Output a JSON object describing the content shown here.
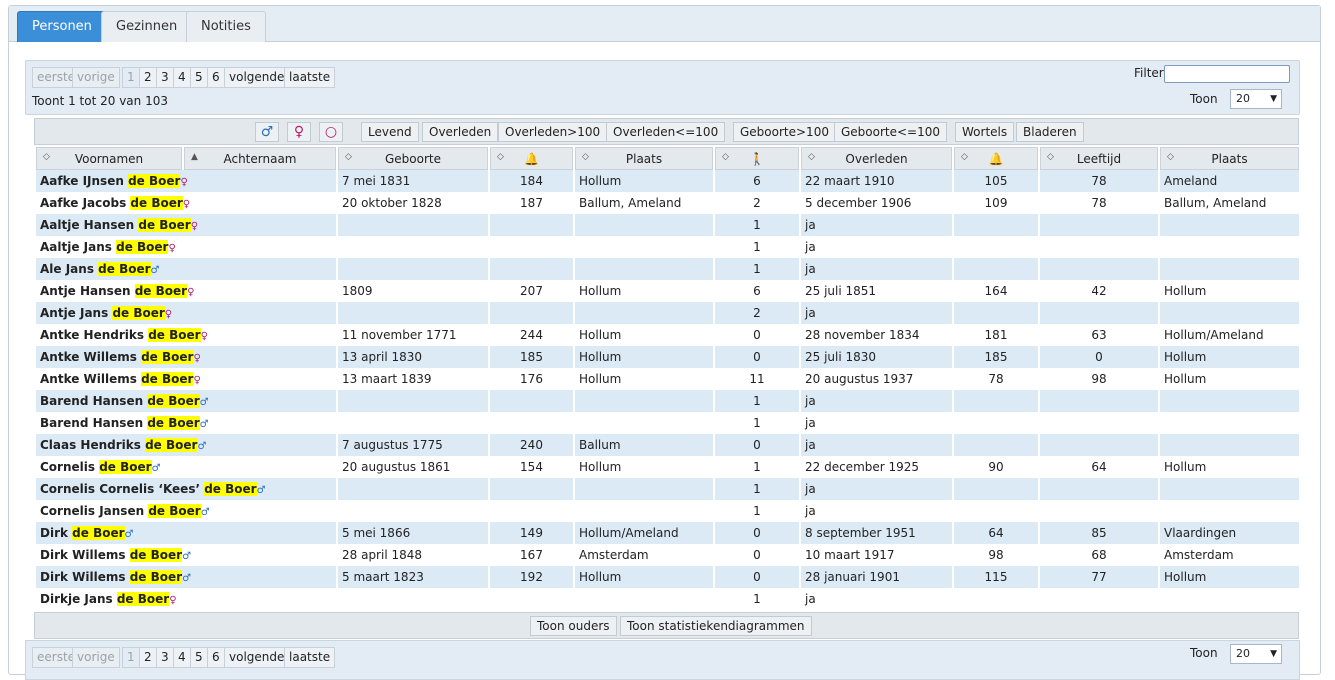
{
  "tabs": [
    "Personen",
    "Gezinnen",
    "Notities"
  ],
  "pager": {
    "first": "eerste",
    "prev": "vorige",
    "pages": [
      "1",
      "2",
      "3",
      "4",
      "5",
      "6"
    ],
    "next": "volgende",
    "last": "laatste",
    "showing": "Toont 1 tot 20 van 103"
  },
  "filter": {
    "label": "Filter",
    "value": ""
  },
  "page_size": {
    "label": "Toon",
    "value": "20"
  },
  "filter_buttons": [
    "Levend",
    "Overleden",
    "Overleden>100",
    "Overleden<=100",
    "Geboorte>100",
    "Geboorte<=100",
    "Wortels",
    "Bladeren"
  ],
  "sex_buttons": {
    "male": "♂",
    "female": "♀",
    "unknown": "○"
  },
  "columns": [
    "Voornamen",
    "Achternaam",
    "Geboorte",
    "",
    "Plaats",
    "",
    "Overleden",
    "",
    "Leeftijd",
    "Plaats"
  ],
  "column_icons": {
    "birth_anniversary": "bell-icon",
    "children": "family-walk-icon",
    "death_anniversary": "bell-icon"
  },
  "rows": [
    {
      "given": "Aafke IJnsen",
      "surname": "de Boer",
      "sex": "♀",
      "birth": "7 mei 1831",
      "ann": "184",
      "bplace": "Hollum",
      "kids": "6",
      "death": "22 maart 1910",
      "dann": "105",
      "age": "78",
      "dplace": "Ameland"
    },
    {
      "given": "Aafke Jacobs",
      "surname": "de Boer",
      "sex": "♀",
      "birth": "20 oktober 1828",
      "ann": "187",
      "bplace": "Ballum, Ameland",
      "kids": "2",
      "death": "5 december 1906",
      "dann": "109",
      "age": "78",
      "dplace": "Ballum, Ameland"
    },
    {
      "given": "Aaltje Hansen",
      "surname": "de Boer",
      "sex": "♀",
      "birth": "",
      "ann": "",
      "bplace": "",
      "kids": "1",
      "death": "ja",
      "dann": "",
      "age": "",
      "dplace": ""
    },
    {
      "given": "Aaltje Jans",
      "surname": "de Boer",
      "sex": "♀",
      "birth": "",
      "ann": "",
      "bplace": "",
      "kids": "1",
      "death": "ja",
      "dann": "",
      "age": "",
      "dplace": ""
    },
    {
      "given": "Ale Jans",
      "surname": "de Boer",
      "sex": "♂",
      "birth": "",
      "ann": "",
      "bplace": "",
      "kids": "1",
      "death": "ja",
      "dann": "",
      "age": "",
      "dplace": ""
    },
    {
      "given": "Antje Hansen",
      "surname": "de Boer",
      "sex": "♀",
      "birth": "1809",
      "ann": "207",
      "bplace": "Hollum",
      "kids": "6",
      "death": "25 juli 1851",
      "dann": "164",
      "age": "42",
      "dplace": "Hollum"
    },
    {
      "given": "Antje Jans",
      "surname": "de Boer",
      "sex": "♀",
      "birth": "",
      "ann": "",
      "bplace": "",
      "kids": "2",
      "death": "ja",
      "dann": "",
      "age": "",
      "dplace": ""
    },
    {
      "given": "Antke Hendriks",
      "surname": "de Boer",
      "sex": "♀",
      "birth": "11 november 1771",
      "ann": "244",
      "bplace": "Hollum",
      "kids": "0",
      "death": "28 november 1834",
      "dann": "181",
      "age": "63",
      "dplace": "Hollum/Ameland"
    },
    {
      "given": "Antke Willems",
      "surname": "de Boer",
      "sex": "♀",
      "birth": "13 april 1830",
      "ann": "185",
      "bplace": "Hollum",
      "kids": "0",
      "death": "25 juli 1830",
      "dann": "185",
      "age": "0",
      "dplace": "Hollum"
    },
    {
      "given": "Antke Willems",
      "surname": "de Boer",
      "sex": "♀",
      "birth": "13 maart 1839",
      "ann": "176",
      "bplace": "Hollum",
      "kids": "11",
      "death": "20 augustus 1937",
      "dann": "78",
      "age": "98",
      "dplace": "Hollum"
    },
    {
      "given": "Barend Hansen",
      "surname": "de Boer",
      "sex": "♂",
      "birth": "",
      "ann": "",
      "bplace": "",
      "kids": "1",
      "death": "ja",
      "dann": "",
      "age": "",
      "dplace": ""
    },
    {
      "given": "Barend Hansen",
      "surname": "de Boer",
      "sex": "♂",
      "birth": "",
      "ann": "",
      "bplace": "",
      "kids": "1",
      "death": "ja",
      "dann": "",
      "age": "",
      "dplace": ""
    },
    {
      "given": "Claas Hendriks",
      "surname": "de Boer",
      "sex": "♂",
      "birth": "7 augustus 1775",
      "ann": "240",
      "bplace": "Ballum",
      "kids": "0",
      "death": "ja",
      "dann": "",
      "age": "",
      "dplace": ""
    },
    {
      "given": "Cornelis",
      "surname": "de Boer",
      "sex": "♂",
      "birth": "20 augustus 1861",
      "ann": "154",
      "bplace": "Hollum",
      "kids": "1",
      "death": "22 december 1925",
      "dann": "90",
      "age": "64",
      "dplace": "Hollum"
    },
    {
      "given": "Cornelis Cornelis ‘Kees’",
      "surname": "de Boer",
      "sex": "♂",
      "birth": "",
      "ann": "",
      "bplace": "",
      "kids": "1",
      "death": "ja",
      "dann": "",
      "age": "",
      "dplace": ""
    },
    {
      "given": "Cornelis Jansen",
      "surname": "de Boer",
      "sex": "♂",
      "birth": "",
      "ann": "",
      "bplace": "",
      "kids": "1",
      "death": "ja",
      "dann": "",
      "age": "",
      "dplace": ""
    },
    {
      "given": "Dirk",
      "surname": "de Boer",
      "sex": "♂",
      "birth": "5 mei 1866",
      "ann": "149",
      "bplace": "Hollum/Ameland",
      "kids": "0",
      "death": "8 september 1951",
      "dann": "64",
      "age": "85",
      "dplace": "Vlaardingen"
    },
    {
      "given": "Dirk Willems",
      "surname": "de Boer",
      "sex": "♂",
      "birth": "28 april 1848",
      "ann": "167",
      "bplace": "Amsterdam",
      "kids": "0",
      "death": "10 maart 1917",
      "dann": "98",
      "age": "68",
      "dplace": "Amsterdam"
    },
    {
      "given": "Dirk Willems",
      "surname": "de Boer",
      "sex": "♂",
      "birth": "5 maart 1823",
      "ann": "192",
      "bplace": "Hollum",
      "kids": "0",
      "death": "28 januari 1901",
      "dann": "115",
      "age": "77",
      "dplace": "Hollum"
    },
    {
      "given": "Dirkje Jans",
      "surname": "de Boer",
      "sex": "♀",
      "birth": "",
      "ann": "",
      "bplace": "",
      "kids": "1",
      "death": "ja",
      "dann": "",
      "age": "",
      "dplace": ""
    }
  ],
  "footer_buttons": [
    "Toon ouders",
    "Toon statistiekendiagrammen"
  ],
  "colors": {
    "tab_active": "#3b8ed8",
    "row_odd": "#dceaf6",
    "highlight": "#ffff00",
    "male": "#2a6fc0",
    "female": "#b0206a"
  }
}
